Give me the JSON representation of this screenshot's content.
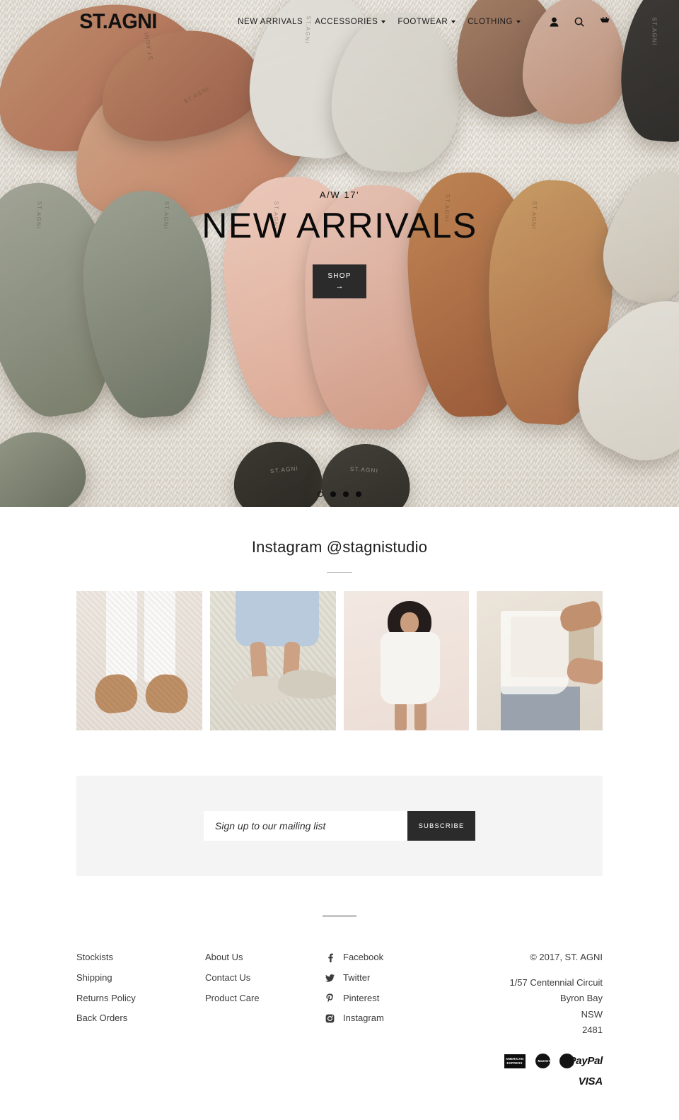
{
  "brand": {
    "logo": "ST.AGNI"
  },
  "nav": {
    "items": [
      {
        "label": "NEW ARRIVALS",
        "has_dropdown": false
      },
      {
        "label": "ACCESSORIES",
        "has_dropdown": true
      },
      {
        "label": "FOOTWEAR",
        "has_dropdown": true
      },
      {
        "label": "CLOTHING",
        "has_dropdown": true
      }
    ],
    "icons": [
      "account-icon",
      "search-icon",
      "cart-icon"
    ]
  },
  "hero": {
    "subtitle": "A/W 17'",
    "title": "NEW ARRIVALS",
    "button_label": "SHOP",
    "button_arrow": "→",
    "slide_count": 4,
    "active_slide": 1
  },
  "instagram": {
    "heading": "Instagram @stagnistudio",
    "tiles": [
      {
        "alt": "woven-tan-flats-white-jeans"
      },
      {
        "alt": "beige-mules-light-denim"
      },
      {
        "alt": "white-linen-dress-model"
      },
      {
        "alt": "sheer-top-tan-bag-detail"
      }
    ]
  },
  "newsletter": {
    "placeholder": "Sign up to our mailing list",
    "value": "",
    "button_label": "SUBSCRIBE"
  },
  "footer": {
    "col1": [
      "Stockists",
      "Shipping",
      "Returns Policy",
      "Back Orders"
    ],
    "col2": [
      "About Us",
      "Contact Us",
      "Product Care"
    ],
    "social": [
      {
        "label": "Facebook",
        "icon": "facebook-icon"
      },
      {
        "label": "Twitter",
        "icon": "twitter-icon"
      },
      {
        "label": "Pinterest",
        "icon": "pinterest-icon"
      },
      {
        "label": "Instagram",
        "icon": "instagram-icon"
      }
    ],
    "copyright": "© 2017, ST. AGNI",
    "address": [
      "1/57 Centennial Circuit",
      "Byron Bay",
      "NSW",
      "2481"
    ],
    "payments": [
      {
        "name": "american-express",
        "label": "AMERICAN EXPRESS"
      },
      {
        "name": "mastercard",
        "label": "MasterCard"
      },
      {
        "name": "paypal",
        "label": "PayPal"
      },
      {
        "name": "visa",
        "label": "VISA"
      }
    ]
  },
  "colors": {
    "accent_dark": "#2b2b2b",
    "page_bg": "#ffffff",
    "newsletter_bg": "#f4f4f4",
    "text": "#3b3b3b"
  }
}
